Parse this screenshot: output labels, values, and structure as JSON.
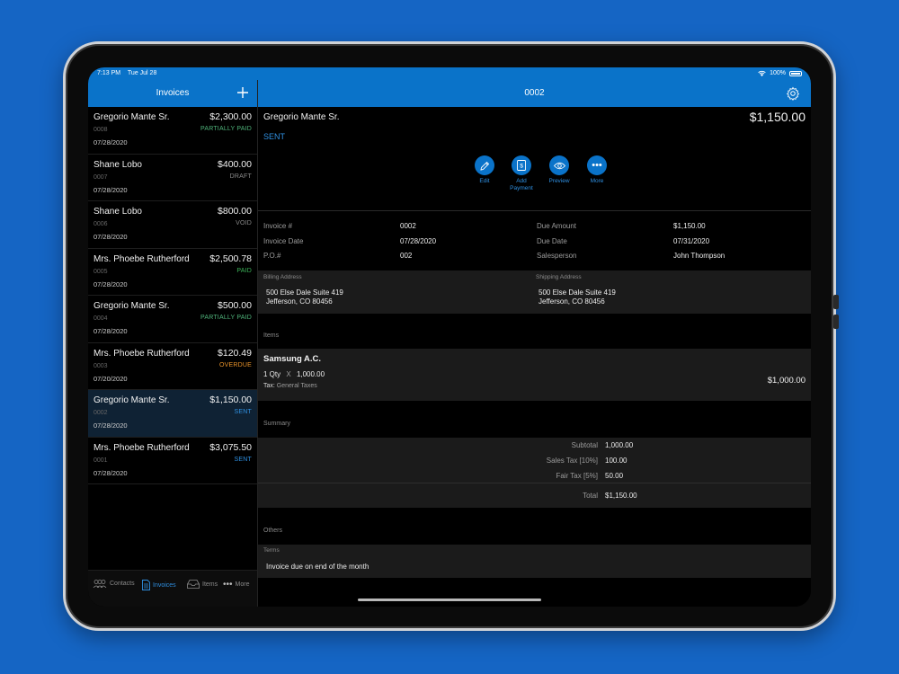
{
  "status_bar": {
    "time": "7:13 PM",
    "date": "Tue Jul 28",
    "battery": "100%"
  },
  "sidebar": {
    "title": "Invoices",
    "add_icon": "plus-icon",
    "invoices": [
      {
        "name": "Gregorio Mante Sr.",
        "amount": "$2,300.00",
        "number": "0008",
        "status": "PARTIALLY PAID",
        "status_color": "#4fb37a",
        "date": "07/28/2020",
        "selected": false
      },
      {
        "name": "Shane Lobo",
        "amount": "$400.00",
        "number": "0007",
        "status": "DRAFT",
        "status_color": "#8a8a8a",
        "date": "07/28/2020",
        "selected": false
      },
      {
        "name": "Shane Lobo",
        "amount": "$800.00",
        "number": "0006",
        "status": "VOID",
        "status_color": "#8a8a8a",
        "date": "07/28/2020",
        "selected": false
      },
      {
        "name": "Mrs. Phoebe Rutherford",
        "amount": "$2,500.78",
        "number": "0005",
        "status": "PAID",
        "status_color": "#3cb55a",
        "date": "07/28/2020",
        "selected": false
      },
      {
        "name": "Gregorio Mante Sr.",
        "amount": "$500.00",
        "number": "0004",
        "status": "PARTIALLY PAID",
        "status_color": "#4fb37a",
        "date": "07/28/2020",
        "selected": false
      },
      {
        "name": "Mrs. Phoebe Rutherford",
        "amount": "$120.49",
        "number": "0003",
        "status": "OVERDUE",
        "status_color": "#e8922a",
        "date": "07/20/2020",
        "selected": false
      },
      {
        "name": "Gregorio Mante Sr.",
        "amount": "$1,150.00",
        "number": "0002",
        "status": "SENT",
        "status_color": "#2f8fe0",
        "date": "07/28/2020",
        "selected": true
      },
      {
        "name": "Mrs. Phoebe Rutherford",
        "amount": "$3,075.50",
        "number": "0001",
        "status": "SENT",
        "status_color": "#2f8fe0",
        "date": "07/28/2020",
        "selected": false
      }
    ],
    "tabs": [
      {
        "label": "Contacts",
        "icon": "contacts-icon",
        "active": false
      },
      {
        "label": "Invoices",
        "icon": "document-icon",
        "active": true
      },
      {
        "label": "Items",
        "icon": "inbox-icon",
        "active": false
      },
      {
        "label": "More",
        "icon": "more-icon",
        "active": false
      }
    ]
  },
  "detail": {
    "header_title": "0002",
    "customer": "Gregorio Mante Sr.",
    "total": "$1,150.00",
    "status": "SENT",
    "actions": [
      {
        "label": "Edit",
        "icon": "pencil-icon"
      },
      {
        "label": "Add Payment",
        "icon": "payment-icon"
      },
      {
        "label": "Preview",
        "icon": "eye-icon"
      },
      {
        "label": "More",
        "icon": "more-icon"
      }
    ],
    "info": {
      "invoice_label": "Invoice #",
      "invoice_value": "0002",
      "date_label": "Invoice Date",
      "date_value": "07/28/2020",
      "po_label": "P.O.#",
      "po_value": "002",
      "due_amount_label": "Due Amount",
      "due_amount_value": "$1,150.00",
      "due_date_label": "Due Date",
      "due_date_value": "07/31/2020",
      "salesperson_label": "Salesperson",
      "salesperson_value": "John Thompson"
    },
    "billing": {
      "label": "Billing Address",
      "line1": "500 Else Dale Suite 419",
      "line2": "Jefferson, CO 80456"
    },
    "shipping": {
      "label": "Shipping Address",
      "line1": "500 Else Dale Suite 419",
      "line2": "Jefferson, CO 80456"
    },
    "items_title": "Items",
    "item": {
      "name": "Samsung A.C.",
      "qty": "1 Qty",
      "x": "X",
      "rate": "1,000.00",
      "tax_label": "Tax:",
      "tax_value": "General Taxes",
      "amount": "$1,000.00"
    },
    "summary_title": "Summary",
    "summary": [
      {
        "label": "Subtotal",
        "value": "1,000.00"
      },
      {
        "label": "Sales Tax [10%]",
        "value": "100.00"
      },
      {
        "label": "Fair Tax [5%]",
        "value": "50.00"
      }
    ],
    "total_label": "Total",
    "total_value": "$1,150.00",
    "others_title": "Others",
    "terms_label": "Terms",
    "terms_value": "Invoice due on end of the month"
  }
}
